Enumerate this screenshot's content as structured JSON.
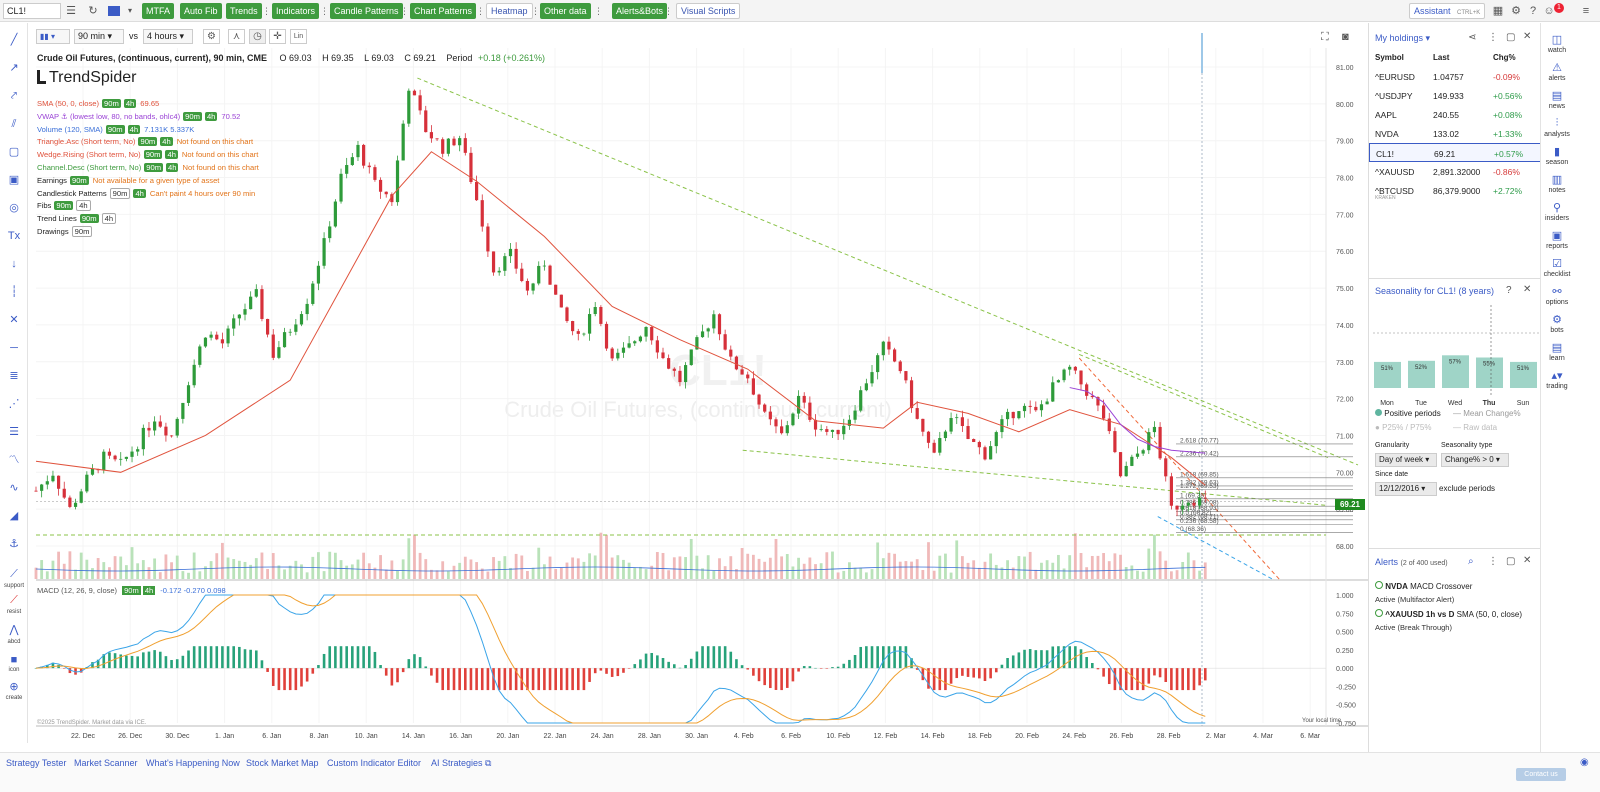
{
  "topbar": {
    "symbol": "CL1!",
    "buttons": [
      "MTFA",
      "Auto Fib",
      "Trends",
      "Indicators",
      "Candle Patterns",
      "Chart Patterns"
    ],
    "white_buttons": [
      "Heatmap"
    ],
    "buttons2": [
      "Other data",
      "Alerts&Bots"
    ],
    "visual_scripts": "Visual Scripts",
    "assistant": "Assistant",
    "assistant_shortcut": "CTRL+K",
    "notif_count": "1"
  },
  "chart_toolbar": {
    "interval": "90 min",
    "vs": "vs",
    "compare_interval": "4 hours",
    "lin": "Lin"
  },
  "chart": {
    "title": "Crude Oil Futures, (continuous, current), 90 min, CME",
    "ohlc": {
      "O": "O 69.03",
      "H": "H 69.35",
      "L": "L 69.03",
      "C": "C 69.21"
    },
    "period": "Period",
    "change": "+0.18 (+0.261%)",
    "logo": "TrendSpider",
    "watermark_symbol": "CL1!",
    "watermark_name": "Crude Oil Futures, (continuous, current)",
    "current_price": "69.21",
    "copyright": "©2025 TrendSpider. Market data via ICE.",
    "local_time": "Your local time",
    "macd_label": "MACD (12, 26, 9, close)",
    "macd_values": "-0.172  -0.270  0.098",
    "tags": {
      "t90": "90m",
      "t4h": "4h"
    }
  },
  "indicators": [
    {
      "name": "SMA (50, 0, close)",
      "value": "69.65",
      "color": "#e0533d"
    },
    {
      "name": "VWAP ⚓ (lowest low, 80, no bands, ohlc4)",
      "value": "70.52",
      "color": "#9b44d6"
    },
    {
      "name": "Volume (120, SMA)",
      "value": "7.131K  5.337K",
      "color": "#3a6fd8"
    },
    {
      "name": "Triangle.Asc (Short term, No)",
      "value": "Not found on this chart",
      "color": "#e0533d"
    },
    {
      "name": "Wedge.Rising (Short term, No)",
      "value": "Not found on this chart",
      "color": "#e0533d"
    },
    {
      "name": "Channel.Desc (Short term, No)",
      "value": "Not found on this chart",
      "color": "#3e9b3e"
    },
    {
      "name": "Earnings",
      "value": "Not available for a given type of asset",
      "color": "#222"
    },
    {
      "name": "Candlestick Patterns",
      "value": "Can't paint 4 hours over 90 min",
      "color": "#222"
    },
    {
      "name": "Fibs",
      "value": "",
      "color": "#222"
    },
    {
      "name": "Trend Lines",
      "value": "",
      "color": "#222"
    },
    {
      "name": "Drawings",
      "value": "",
      "color": "#222"
    }
  ],
  "chart_data": {
    "type": "candlestick",
    "title": "Crude Oil Futures, (continuous, current), 90 min, CME",
    "y_ticks": [
      "81.00",
      "80.00",
      "79.00",
      "78.00",
      "77.00",
      "76.00",
      "75.00",
      "74.00",
      "73.00",
      "72.00",
      "71.00",
      "70.00",
      "69.00",
      "68.00"
    ],
    "macd_ticks": [
      "1.000",
      "0.750",
      "0.500",
      "0.250",
      "0.000",
      "-0.250",
      "-0.500",
      "-0.750"
    ],
    "x_ticks": [
      "22. Dec",
      "26. Dec",
      "30. Dec",
      "1. Jan",
      "6. Jan",
      "8. Jan",
      "10. Jan",
      "14. Jan",
      "16. Jan",
      "20. Jan",
      "22. Jan",
      "24. Jan",
      "28. Jan",
      "30. Jan",
      "4. Feb",
      "6. Feb",
      "10. Feb",
      "12. Feb",
      "14. Feb",
      "18. Feb",
      "20. Feb",
      "24. Feb",
      "26. Feb",
      "28. Feb",
      "2. Mar",
      "4. Mar",
      "6. Mar"
    ],
    "close_path": [
      [
        0,
        69.5
      ],
      [
        3,
        70.0
      ],
      [
        6,
        69.0
      ],
      [
        9,
        69.8
      ],
      [
        12,
        70.4
      ],
      [
        15,
        70.2
      ],
      [
        18,
        70.8
      ],
      [
        21,
        71.5
      ],
      [
        24,
        71.0
      ],
      [
        27,
        72.5
      ],
      [
        30,
        73.8
      ],
      [
        33,
        73.5
      ],
      [
        36,
        74.3
      ],
      [
        39,
        74.8
      ],
      [
        42,
        73.2
      ],
      [
        45,
        73.9
      ],
      [
        48,
        74.7
      ],
      [
        51,
        76.2
      ],
      [
        54,
        78.0
      ],
      [
        57,
        78.8
      ],
      [
        60,
        77.8
      ],
      [
        63,
        77.4
      ],
      [
        66,
        80.5
      ],
      [
        69,
        79.3
      ],
      [
        72,
        78.8
      ],
      [
        75,
        79.1
      ],
      [
        78,
        77.4
      ],
      [
        81,
        75.5
      ],
      [
        84,
        75.9
      ],
      [
        87,
        74.9
      ],
      [
        90,
        75.7
      ],
      [
        93,
        74.3
      ],
      [
        96,
        73.6
      ],
      [
        99,
        74.6
      ],
      [
        102,
        73.0
      ],
      [
        105,
        73.4
      ],
      [
        108,
        74.0
      ],
      [
        111,
        73.1
      ],
      [
        114,
        72.5
      ],
      [
        117,
        73.5
      ],
      [
        120,
        74.3
      ],
      [
        123,
        73.0
      ],
      [
        126,
        72.6
      ],
      [
        129,
        71.5
      ],
      [
        132,
        71.0
      ],
      [
        135,
        72.0
      ],
      [
        138,
        71.3
      ],
      [
        141,
        71.0
      ],
      [
        144,
        71.5
      ],
      [
        147,
        72.5
      ],
      [
        150,
        73.4
      ],
      [
        153,
        72.8
      ],
      [
        156,
        71.4
      ],
      [
        159,
        70.4
      ],
      [
        162,
        71.6
      ],
      [
        165,
        70.9
      ],
      [
        168,
        70.5
      ],
      [
        171,
        71.3
      ],
      [
        174,
        71.8
      ],
      [
        177,
        71.6
      ],
      [
        180,
        72.3
      ],
      [
        183,
        72.8
      ],
      [
        186,
        72.2
      ],
      [
        189,
        71.5
      ],
      [
        192,
        69.9
      ],
      [
        195,
        70.5
      ],
      [
        198,
        71.2
      ],
      [
        201,
        69.0
      ],
      [
        204,
        69.3
      ],
      [
        207,
        69.21
      ]
    ],
    "sma50": [
      [
        0,
        70.3
      ],
      [
        15,
        70.0
      ],
      [
        30,
        71.0
      ],
      [
        45,
        72.5
      ],
      [
        54,
        75.0
      ],
      [
        63,
        77.5
      ],
      [
        70,
        78.7
      ],
      [
        78,
        77.9
      ],
      [
        90,
        76.4
      ],
      [
        102,
        74.5
      ],
      [
        114,
        73.6
      ],
      [
        126,
        72.8
      ],
      [
        138,
        71.4
      ],
      [
        150,
        71.2
      ],
      [
        156,
        71.9
      ],
      [
        165,
        71.6
      ],
      [
        174,
        71.1
      ],
      [
        183,
        71.7
      ],
      [
        192,
        71.3
      ],
      [
        201,
        70.4
      ],
      [
        207,
        69.65
      ]
    ],
    "fib_levels": [
      {
        "label": "2.618 (70.77)",
        "price": 70.77
      },
      {
        "label": "2.236 (70.42)",
        "price": 70.42
      },
      {
        "label": "1.618 (69.85)",
        "price": 69.85
      },
      {
        "label": "1.382 (69.63)",
        "price": 69.63
      },
      {
        "label": "1.272 (69.53)",
        "price": 69.53
      },
      {
        "label": "1 (69.28)",
        "price": 69.28
      },
      {
        "label": "0.786 (69.08)",
        "price": 69.08
      },
      {
        "label": "0.618 (68.93)",
        "price": 68.93
      },
      {
        "label": "0.5 (68.82)",
        "price": 68.82
      },
      {
        "label": "0.382 (68.71)",
        "price": 68.71
      },
      {
        "label": "0.236 (68.58)",
        "price": 68.58
      },
      {
        "label": "0 (68.36)",
        "price": 68.36
      }
    ]
  },
  "holdings": {
    "title": "My holdings",
    "headers": [
      "Symbol",
      "Last",
      "Chg%"
    ],
    "rows": [
      {
        "symbol": "^EURUSD",
        "last": "1.04757",
        "chg": "-0.09%",
        "up": false
      },
      {
        "symbol": "^USDJPY",
        "last": "149.933",
        "chg": "+0.56%",
        "up": true
      },
      {
        "symbol": "AAPL",
        "last": "240.55",
        "chg": "+0.08%",
        "up": true
      },
      {
        "symbol": "NVDA",
        "last": "133.02",
        "chg": "+1.33%",
        "up": true
      },
      {
        "symbol": "CL1!",
        "last": "69.21",
        "chg": "+0.57%",
        "up": true
      },
      {
        "symbol": "^XAUUSD",
        "last": "2,891.32000",
        "chg": "-0.86%",
        "up": false
      },
      {
        "symbol": "^BTCUSD",
        "last": "86,379.9000",
        "chg": "+2.72%",
        "up": true
      }
    ],
    "btc_sub": "KRAKEN"
  },
  "seasonality": {
    "title": "Seasonality for CL1! (8 years)",
    "days": [
      "Mon",
      "Tue",
      "Wed",
      "Thu",
      "Sun"
    ],
    "pcts": [
      "51%",
      "52%",
      "57%",
      "55%",
      "51%"
    ],
    "values": [
      51,
      52,
      57,
      55,
      51
    ],
    "legend": {
      "pos": "Positive periods",
      "mean": "Mean Change%",
      "pct": "P25% / P75%",
      "raw": "Raw data"
    },
    "granularity_label": "Granularity",
    "granularity": "Day of week",
    "type_label": "Seasonality type",
    "type": "Change% > 0",
    "since_label": "Since date",
    "since": "12/12/2016",
    "exclude": "exclude periods"
  },
  "alerts": {
    "title": "Alerts",
    "count": "(2 of 400 used)",
    "items": [
      {
        "sym": "NVDA",
        "desc": "MACD Crossover",
        "status": "Active (Multifactor Alert)"
      },
      {
        "sym": "^XAUUSD",
        "tf": "1h vs D",
        "desc": "SMA (50, 0, close)",
        "status": "Active (Break Through)"
      }
    ]
  },
  "right_rail": [
    "watch",
    "alerts",
    "news",
    "analysts",
    "season",
    "notes",
    "insiders",
    "reports",
    "checklist",
    "options",
    "bots",
    "learn",
    "trading"
  ],
  "left_labels": [
    "support",
    "resist",
    "abcd",
    "icon",
    "create"
  ],
  "bottom_links": [
    "Strategy Tester",
    "Market Scanner",
    "What's Happening Now",
    "Stock Market Map",
    "Custom Indicator Editor",
    "AI Strategies"
  ],
  "contact": "Contact us"
}
